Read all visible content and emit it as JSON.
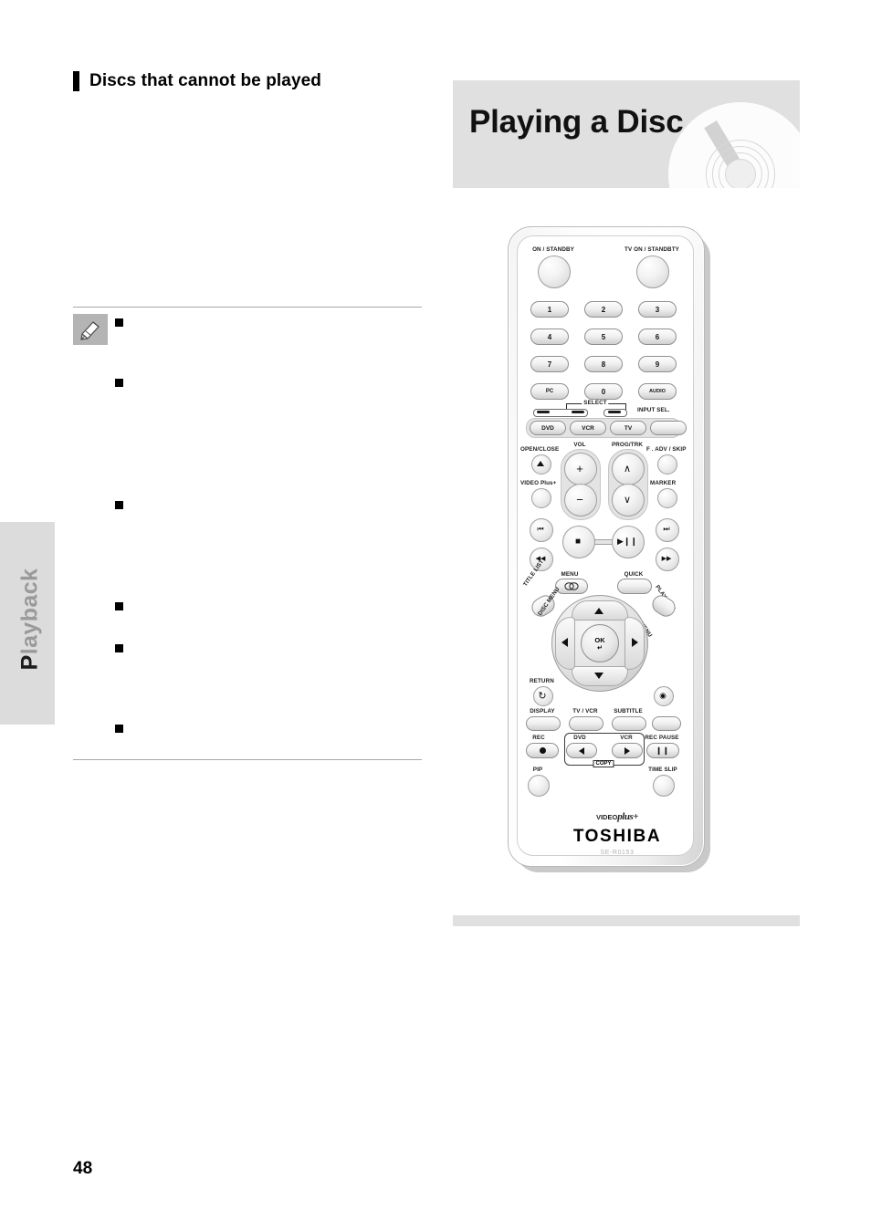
{
  "page": {
    "number": "48",
    "sidebar_tab": "Playback"
  },
  "left_column": {
    "heading": "Discs that cannot be played",
    "note_icon": "pencil-note-icon",
    "bullets": [
      {
        "text": ""
      },
      {
        "text": ""
      },
      {
        "text": ""
      },
      {
        "text": ""
      },
      {
        "text": ""
      },
      {
        "text": ""
      }
    ]
  },
  "right_column": {
    "header_title": "Playing a Disc",
    "header_graphic": "compact-disc-icon"
  },
  "remote": {
    "brand": "TOSHIBA",
    "model": "SE-R0153",
    "video_plus_logo": "VIDEO Plus+",
    "power": {
      "left": "ON / STANDBY",
      "right": "TV ON / STANDBTY"
    },
    "numeric_keys": [
      "1",
      "2",
      "3",
      "4",
      "5",
      "6",
      "7",
      "8",
      "9"
    ],
    "key_pc": "PC",
    "key_zero": "0",
    "key_audio": "AUDIO",
    "select_label": "SELECT",
    "input_sel_label": "INPUT SEL.",
    "mode_keys": [
      "DVD",
      "VCR",
      "TV"
    ],
    "open_close": "OPEN/CLOSE",
    "video_plus_btn": "VIDEO Plus+",
    "vol_label": "VOL",
    "vol_plus": "+",
    "vol_minus": "−",
    "prog_trk_label": "PROG/TRK",
    "prog_up": "∧",
    "prog_down": "∨",
    "f_adv_skip": "F . ADV / SKIP",
    "marker": "MARKER",
    "transport": {
      "prev": "⏮",
      "rew": "◀◀",
      "stop": "■",
      "play_pause": "▶❙❙",
      "next": "⏭",
      "ffwd": "▶▶"
    },
    "menu_label": "MENU",
    "quick_label": "QUICK",
    "title_list": "TITLE LIST",
    "disc_menu": "DISC MENU",
    "top_menu": "TOP MENU",
    "play_list": "PLAY LIST",
    "ok_label": "OK",
    "return_label": "RETURN",
    "row_display": [
      "DISPLAY",
      "TV / VCR",
      "SUBTITLE"
    ],
    "rec_label": "REC",
    "copy_dvd": "DVD",
    "copy_vcr": "VCR",
    "copy_label": "COPY",
    "rec_pause": "REC PAUSE",
    "pip_label": "PIP",
    "time_slip": "TIME SLIP"
  }
}
